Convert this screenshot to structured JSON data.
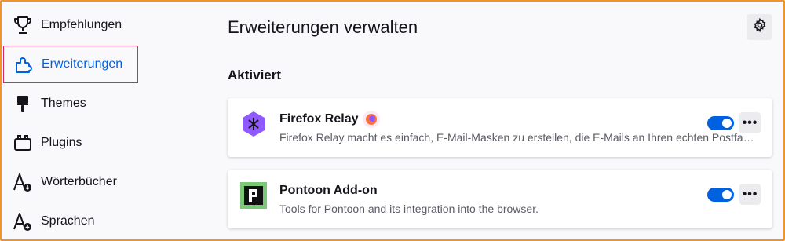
{
  "sidebar": {
    "items": [
      {
        "label": "Empfehlungen",
        "icon": "trophy-icon"
      },
      {
        "label": "Erweiterungen",
        "icon": "puzzle-icon",
        "selected": true
      },
      {
        "label": "Themes",
        "icon": "paintbrush-icon"
      },
      {
        "label": "Plugins",
        "icon": "plugin-icon"
      },
      {
        "label": "Wörterbücher",
        "icon": "dictionary-icon"
      },
      {
        "label": "Sprachen",
        "icon": "language-icon"
      }
    ]
  },
  "main": {
    "title": "Erweiterungen verwalten",
    "settings_icon": "gear-icon",
    "section_title": "Aktiviert",
    "addons": [
      {
        "name": "Firefox Relay",
        "description": "Firefox Relay macht es einfach, E-Mail-Masken zu erstellen, die E-Mails an Ihren echten Postfach weiterleiten.",
        "icon": "firefox-relay-icon",
        "badge": "firefox-recommended-badge-icon",
        "enabled": true,
        "more_label": "•••"
      },
      {
        "name": "Pontoon Add-on",
        "description": "Tools for Pontoon and its integration into the browser.",
        "icon": "pontoon-icon",
        "enabled": true,
        "more_label": "•••"
      }
    ]
  },
  "colors": {
    "accent": "#0061e0",
    "focus_outline": "#e22850",
    "window_border": "#f0932b",
    "relay_purple": "#9059ff",
    "pontoon_green": "#7bc876"
  }
}
